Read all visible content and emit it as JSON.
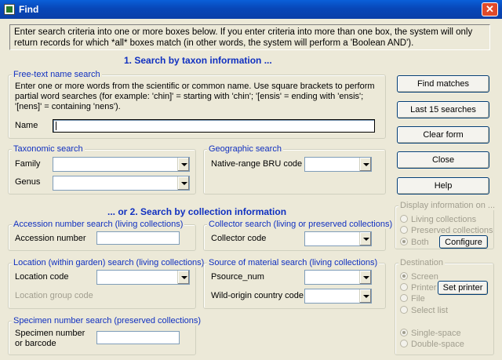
{
  "window": {
    "title": "Find",
    "close_glyph": "✕"
  },
  "intro": "Enter search criteria into one or more boxes below.  If you enter criteria into more than one box, the system will only return records for which *all* boxes match (in other words, the system will perform a 'Boolean AND').",
  "section1_heading": "1.  Search by taxon information ...",
  "free_text": {
    "legend": "Free-text name search",
    "description": "Enter one or more words from the scientific or common name.  Use square brackets to perform partial word searches (for example: 'chin]' = starting with 'chin'; '[ensis' = ending with 'ensis'; '[nens]' = containing 'nens').",
    "name_label": "Name",
    "name_value": ""
  },
  "taxonomic": {
    "legend": "Taxonomic search",
    "family_label": "Family",
    "genus_label": "Genus"
  },
  "geographic": {
    "legend": "Geographic search",
    "bru_label": "Native-range BRU code"
  },
  "section2_heading": "... or 2.  Search by collection information",
  "accession": {
    "legend": "Accession number search (living collections)",
    "label": "Accession number"
  },
  "collector": {
    "legend": "Collector search (living or preserved collections)",
    "label": "Collector code"
  },
  "location": {
    "legend": "Location (within garden) search (living collections)",
    "code_label": "Location code",
    "group_label": "Location group code"
  },
  "source": {
    "legend": "Source of material search (living collections)",
    "psource_label": "Psource_num",
    "country_label": "Wild-origin country code"
  },
  "specimen": {
    "legend": "Specimen number search (preserved collections)",
    "label": "Specimen number or barcode"
  },
  "buttons": {
    "find": "Find matches",
    "last15": "Last 15 searches",
    "clear": "Clear form",
    "close": "Close",
    "help": "Help",
    "configure": "Configure",
    "set_printer": "Set printer"
  },
  "display_info": {
    "legend": "Display information on ...",
    "options": [
      "Living collections",
      "Preserved collections",
      "Both"
    ],
    "selected": "Both"
  },
  "destination": {
    "legend": "Destination",
    "options": [
      "Screen",
      "Printer",
      "File",
      "Select list"
    ],
    "selected": "Screen",
    "spacing_options": [
      "Single-space",
      "Double-space"
    ],
    "spacing_selected": "Single-space"
  }
}
